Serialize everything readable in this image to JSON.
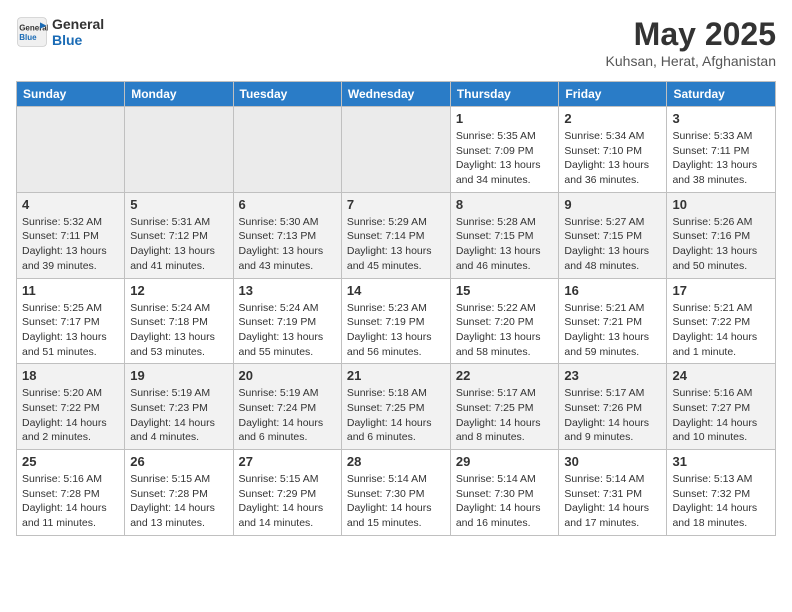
{
  "header": {
    "logo_line1": "General",
    "logo_line2": "Blue",
    "title": "May 2025",
    "subtitle": "Kuhsan, Herat, Afghanistan"
  },
  "calendar": {
    "days_of_week": [
      "Sunday",
      "Monday",
      "Tuesday",
      "Wednesday",
      "Thursday",
      "Friday",
      "Saturday"
    ],
    "weeks": [
      [
        {
          "day": "",
          "info": "",
          "empty": true
        },
        {
          "day": "",
          "info": "",
          "empty": true
        },
        {
          "day": "",
          "info": "",
          "empty": true
        },
        {
          "day": "",
          "info": "",
          "empty": true
        },
        {
          "day": "1",
          "info": "Sunrise: 5:35 AM\nSunset: 7:09 PM\nDaylight: 13 hours\nand 34 minutes.",
          "empty": false
        },
        {
          "day": "2",
          "info": "Sunrise: 5:34 AM\nSunset: 7:10 PM\nDaylight: 13 hours\nand 36 minutes.",
          "empty": false
        },
        {
          "day": "3",
          "info": "Sunrise: 5:33 AM\nSunset: 7:11 PM\nDaylight: 13 hours\nand 38 minutes.",
          "empty": false
        }
      ],
      [
        {
          "day": "4",
          "info": "Sunrise: 5:32 AM\nSunset: 7:11 PM\nDaylight: 13 hours\nand 39 minutes.",
          "empty": false
        },
        {
          "day": "5",
          "info": "Sunrise: 5:31 AM\nSunset: 7:12 PM\nDaylight: 13 hours\nand 41 minutes.",
          "empty": false
        },
        {
          "day": "6",
          "info": "Sunrise: 5:30 AM\nSunset: 7:13 PM\nDaylight: 13 hours\nand 43 minutes.",
          "empty": false
        },
        {
          "day": "7",
          "info": "Sunrise: 5:29 AM\nSunset: 7:14 PM\nDaylight: 13 hours\nand 45 minutes.",
          "empty": false
        },
        {
          "day": "8",
          "info": "Sunrise: 5:28 AM\nSunset: 7:15 PM\nDaylight: 13 hours\nand 46 minutes.",
          "empty": false
        },
        {
          "day": "9",
          "info": "Sunrise: 5:27 AM\nSunset: 7:15 PM\nDaylight: 13 hours\nand 48 minutes.",
          "empty": false
        },
        {
          "day": "10",
          "info": "Sunrise: 5:26 AM\nSunset: 7:16 PM\nDaylight: 13 hours\nand 50 minutes.",
          "empty": false
        }
      ],
      [
        {
          "day": "11",
          "info": "Sunrise: 5:25 AM\nSunset: 7:17 PM\nDaylight: 13 hours\nand 51 minutes.",
          "empty": false
        },
        {
          "day": "12",
          "info": "Sunrise: 5:24 AM\nSunset: 7:18 PM\nDaylight: 13 hours\nand 53 minutes.",
          "empty": false
        },
        {
          "day": "13",
          "info": "Sunrise: 5:24 AM\nSunset: 7:19 PM\nDaylight: 13 hours\nand 55 minutes.",
          "empty": false
        },
        {
          "day": "14",
          "info": "Sunrise: 5:23 AM\nSunset: 7:19 PM\nDaylight: 13 hours\nand 56 minutes.",
          "empty": false
        },
        {
          "day": "15",
          "info": "Sunrise: 5:22 AM\nSunset: 7:20 PM\nDaylight: 13 hours\nand 58 minutes.",
          "empty": false
        },
        {
          "day": "16",
          "info": "Sunrise: 5:21 AM\nSunset: 7:21 PM\nDaylight: 13 hours\nand 59 minutes.",
          "empty": false
        },
        {
          "day": "17",
          "info": "Sunrise: 5:21 AM\nSunset: 7:22 PM\nDaylight: 14 hours\nand 1 minute.",
          "empty": false
        }
      ],
      [
        {
          "day": "18",
          "info": "Sunrise: 5:20 AM\nSunset: 7:22 PM\nDaylight: 14 hours\nand 2 minutes.",
          "empty": false
        },
        {
          "day": "19",
          "info": "Sunrise: 5:19 AM\nSunset: 7:23 PM\nDaylight: 14 hours\nand 4 minutes.",
          "empty": false
        },
        {
          "day": "20",
          "info": "Sunrise: 5:19 AM\nSunset: 7:24 PM\nDaylight: 14 hours\nand 6 minutes.",
          "empty": false
        },
        {
          "day": "21",
          "info": "Sunrise: 5:18 AM\nSunset: 7:25 PM\nDaylight: 14 hours\nand 6 minutes.",
          "empty": false
        },
        {
          "day": "22",
          "info": "Sunrise: 5:17 AM\nSunset: 7:25 PM\nDaylight: 14 hours\nand 8 minutes.",
          "empty": false
        },
        {
          "day": "23",
          "info": "Sunrise: 5:17 AM\nSunset: 7:26 PM\nDaylight: 14 hours\nand 9 minutes.",
          "empty": false
        },
        {
          "day": "24",
          "info": "Sunrise: 5:16 AM\nSunset: 7:27 PM\nDaylight: 14 hours\nand 10 minutes.",
          "empty": false
        }
      ],
      [
        {
          "day": "25",
          "info": "Sunrise: 5:16 AM\nSunset: 7:28 PM\nDaylight: 14 hours\nand 11 minutes.",
          "empty": false
        },
        {
          "day": "26",
          "info": "Sunrise: 5:15 AM\nSunset: 7:28 PM\nDaylight: 14 hours\nand 13 minutes.",
          "empty": false
        },
        {
          "day": "27",
          "info": "Sunrise: 5:15 AM\nSunset: 7:29 PM\nDaylight: 14 hours\nand 14 minutes.",
          "empty": false
        },
        {
          "day": "28",
          "info": "Sunrise: 5:14 AM\nSunset: 7:30 PM\nDaylight: 14 hours\nand 15 minutes.",
          "empty": false
        },
        {
          "day": "29",
          "info": "Sunrise: 5:14 AM\nSunset: 7:30 PM\nDaylight: 14 hours\nand 16 minutes.",
          "empty": false
        },
        {
          "day": "30",
          "info": "Sunrise: 5:14 AM\nSunset: 7:31 PM\nDaylight: 14 hours\nand 17 minutes.",
          "empty": false
        },
        {
          "day": "31",
          "info": "Sunrise: 5:13 AM\nSunset: 7:32 PM\nDaylight: 14 hours\nand 18 minutes.",
          "empty": false
        }
      ]
    ]
  }
}
